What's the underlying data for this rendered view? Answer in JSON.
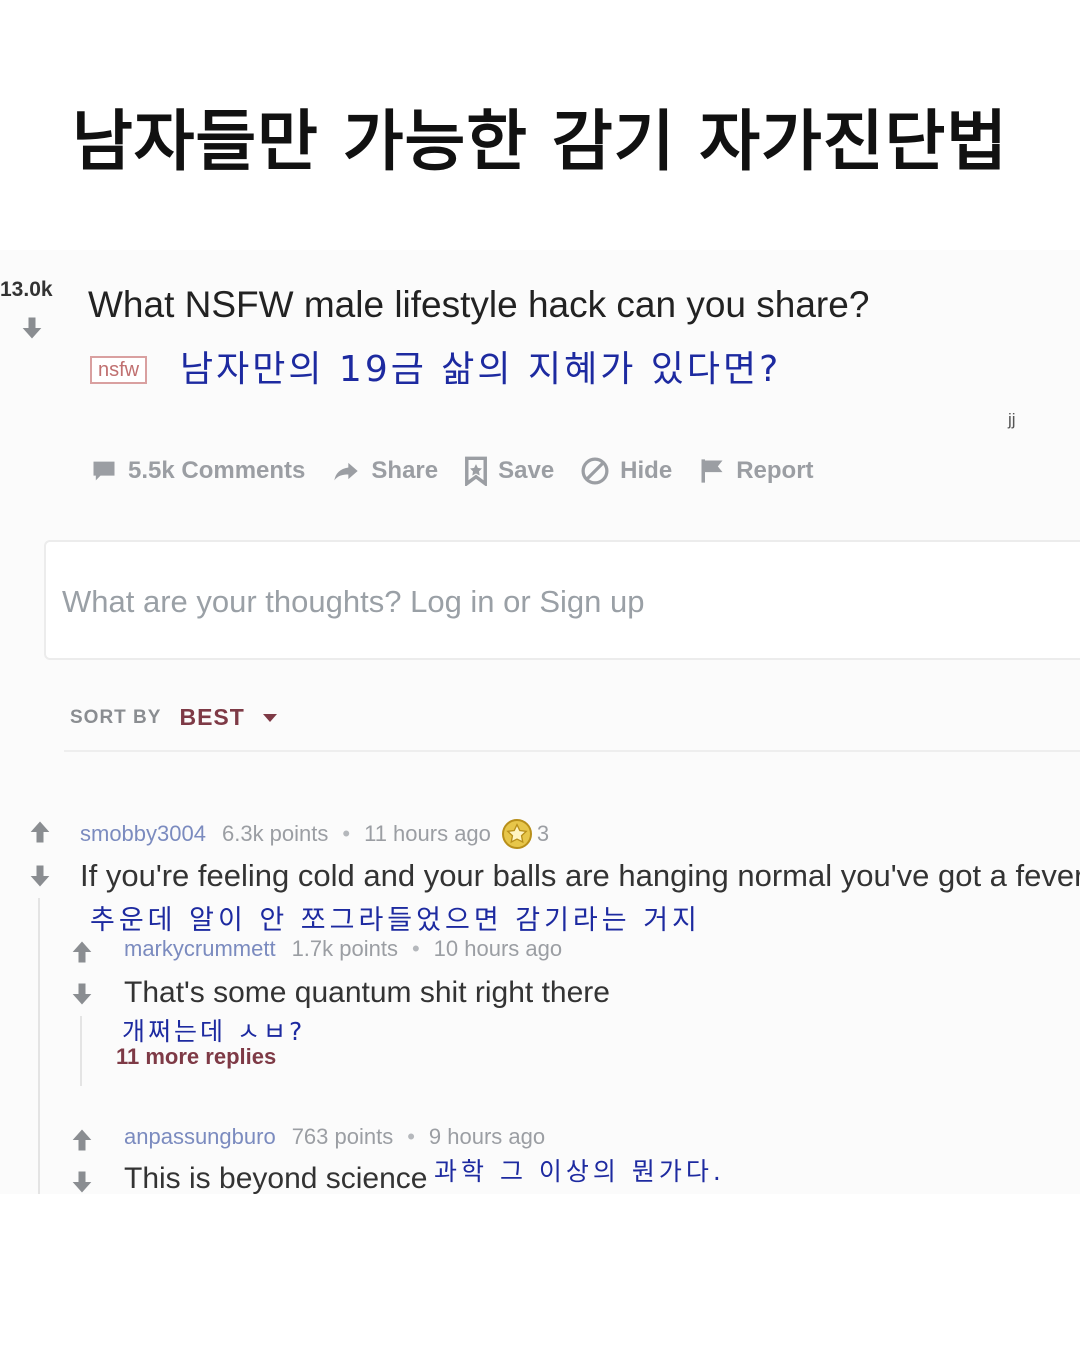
{
  "headline": "남자들만 가능한 감기 자가진단법",
  "post": {
    "score": "13.0k",
    "title": "What NSFW male lifestyle hack can you share?",
    "tag": "nsfw",
    "handwritten": "남자만의 19금 삶의 지혜가 있다면?",
    "watermark": "jj",
    "actions": [
      {
        "label": "5.5k Comments",
        "icon": "comment-icon"
      },
      {
        "label": "Share",
        "icon": "share-icon"
      },
      {
        "label": "Save",
        "icon": "bookmark-icon"
      },
      {
        "label": "Hide",
        "icon": "hide-icon"
      },
      {
        "label": "Report",
        "icon": "flag-icon"
      }
    ]
  },
  "comment_box": {
    "placeholder": "What are your thoughts? Log in or Sign up"
  },
  "sort": {
    "label": "SORT BY",
    "value": "BEST"
  },
  "comments": [
    {
      "author": "smobby3004",
      "points": "6.3k points",
      "time": "11 hours ago",
      "awards": "3",
      "text": "If you're feeling cold and your balls are hanging normal you've got a fever",
      "handwritten": "추운데 알이 안 쪼그라들었으면 감기라는 거지"
    },
    {
      "author": "markycrummett",
      "points": "1.7k points",
      "time": "10 hours ago",
      "text": "That's some quantum shit right there",
      "handwritten": "개쩌는데 ㅅㅂ?",
      "more_replies": "11 more replies"
    },
    {
      "author": "anpassungburo",
      "points": "763 points",
      "time": "9 hours ago",
      "text": "This is beyond science",
      "handwritten": "과학 그 이상의 뭔가다."
    }
  ],
  "colors": {
    "accent": "#7e3a46",
    "author": "#7b8bbf",
    "muted": "#9b9ea3",
    "ink": "#1d2aa0"
  }
}
